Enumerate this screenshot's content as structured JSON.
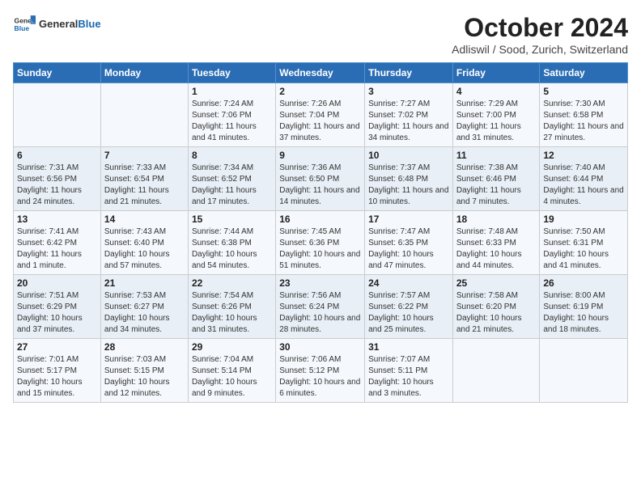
{
  "header": {
    "logo_general": "General",
    "logo_blue": "Blue",
    "month": "October 2024",
    "location": "Adliswil / Sood, Zurich, Switzerland"
  },
  "weekdays": [
    "Sunday",
    "Monday",
    "Tuesday",
    "Wednesday",
    "Thursday",
    "Friday",
    "Saturday"
  ],
  "weeks": [
    [
      {
        "day": "",
        "info": ""
      },
      {
        "day": "",
        "info": ""
      },
      {
        "day": "1",
        "info": "Sunrise: 7:24 AM\nSunset: 7:06 PM\nDaylight: 11 hours and 41 minutes."
      },
      {
        "day": "2",
        "info": "Sunrise: 7:26 AM\nSunset: 7:04 PM\nDaylight: 11 hours and 37 minutes."
      },
      {
        "day": "3",
        "info": "Sunrise: 7:27 AM\nSunset: 7:02 PM\nDaylight: 11 hours and 34 minutes."
      },
      {
        "day": "4",
        "info": "Sunrise: 7:29 AM\nSunset: 7:00 PM\nDaylight: 11 hours and 31 minutes."
      },
      {
        "day": "5",
        "info": "Sunrise: 7:30 AM\nSunset: 6:58 PM\nDaylight: 11 hours and 27 minutes."
      }
    ],
    [
      {
        "day": "6",
        "info": "Sunrise: 7:31 AM\nSunset: 6:56 PM\nDaylight: 11 hours and 24 minutes."
      },
      {
        "day": "7",
        "info": "Sunrise: 7:33 AM\nSunset: 6:54 PM\nDaylight: 11 hours and 21 minutes."
      },
      {
        "day": "8",
        "info": "Sunrise: 7:34 AM\nSunset: 6:52 PM\nDaylight: 11 hours and 17 minutes."
      },
      {
        "day": "9",
        "info": "Sunrise: 7:36 AM\nSunset: 6:50 PM\nDaylight: 11 hours and 14 minutes."
      },
      {
        "day": "10",
        "info": "Sunrise: 7:37 AM\nSunset: 6:48 PM\nDaylight: 11 hours and 10 minutes."
      },
      {
        "day": "11",
        "info": "Sunrise: 7:38 AM\nSunset: 6:46 PM\nDaylight: 11 hours and 7 minutes."
      },
      {
        "day": "12",
        "info": "Sunrise: 7:40 AM\nSunset: 6:44 PM\nDaylight: 11 hours and 4 minutes."
      }
    ],
    [
      {
        "day": "13",
        "info": "Sunrise: 7:41 AM\nSunset: 6:42 PM\nDaylight: 11 hours and 1 minute."
      },
      {
        "day": "14",
        "info": "Sunrise: 7:43 AM\nSunset: 6:40 PM\nDaylight: 10 hours and 57 minutes."
      },
      {
        "day": "15",
        "info": "Sunrise: 7:44 AM\nSunset: 6:38 PM\nDaylight: 10 hours and 54 minutes."
      },
      {
        "day": "16",
        "info": "Sunrise: 7:45 AM\nSunset: 6:36 PM\nDaylight: 10 hours and 51 minutes."
      },
      {
        "day": "17",
        "info": "Sunrise: 7:47 AM\nSunset: 6:35 PM\nDaylight: 10 hours and 47 minutes."
      },
      {
        "day": "18",
        "info": "Sunrise: 7:48 AM\nSunset: 6:33 PM\nDaylight: 10 hours and 44 minutes."
      },
      {
        "day": "19",
        "info": "Sunrise: 7:50 AM\nSunset: 6:31 PM\nDaylight: 10 hours and 41 minutes."
      }
    ],
    [
      {
        "day": "20",
        "info": "Sunrise: 7:51 AM\nSunset: 6:29 PM\nDaylight: 10 hours and 37 minutes."
      },
      {
        "day": "21",
        "info": "Sunrise: 7:53 AM\nSunset: 6:27 PM\nDaylight: 10 hours and 34 minutes."
      },
      {
        "day": "22",
        "info": "Sunrise: 7:54 AM\nSunset: 6:26 PM\nDaylight: 10 hours and 31 minutes."
      },
      {
        "day": "23",
        "info": "Sunrise: 7:56 AM\nSunset: 6:24 PM\nDaylight: 10 hours and 28 minutes."
      },
      {
        "day": "24",
        "info": "Sunrise: 7:57 AM\nSunset: 6:22 PM\nDaylight: 10 hours and 25 minutes."
      },
      {
        "day": "25",
        "info": "Sunrise: 7:58 AM\nSunset: 6:20 PM\nDaylight: 10 hours and 21 minutes."
      },
      {
        "day": "26",
        "info": "Sunrise: 8:00 AM\nSunset: 6:19 PM\nDaylight: 10 hours and 18 minutes."
      }
    ],
    [
      {
        "day": "27",
        "info": "Sunrise: 7:01 AM\nSunset: 5:17 PM\nDaylight: 10 hours and 15 minutes."
      },
      {
        "day": "28",
        "info": "Sunrise: 7:03 AM\nSunset: 5:15 PM\nDaylight: 10 hours and 12 minutes."
      },
      {
        "day": "29",
        "info": "Sunrise: 7:04 AM\nSunset: 5:14 PM\nDaylight: 10 hours and 9 minutes."
      },
      {
        "day": "30",
        "info": "Sunrise: 7:06 AM\nSunset: 5:12 PM\nDaylight: 10 hours and 6 minutes."
      },
      {
        "day": "31",
        "info": "Sunrise: 7:07 AM\nSunset: 5:11 PM\nDaylight: 10 hours and 3 minutes."
      },
      {
        "day": "",
        "info": ""
      },
      {
        "day": "",
        "info": ""
      }
    ]
  ]
}
